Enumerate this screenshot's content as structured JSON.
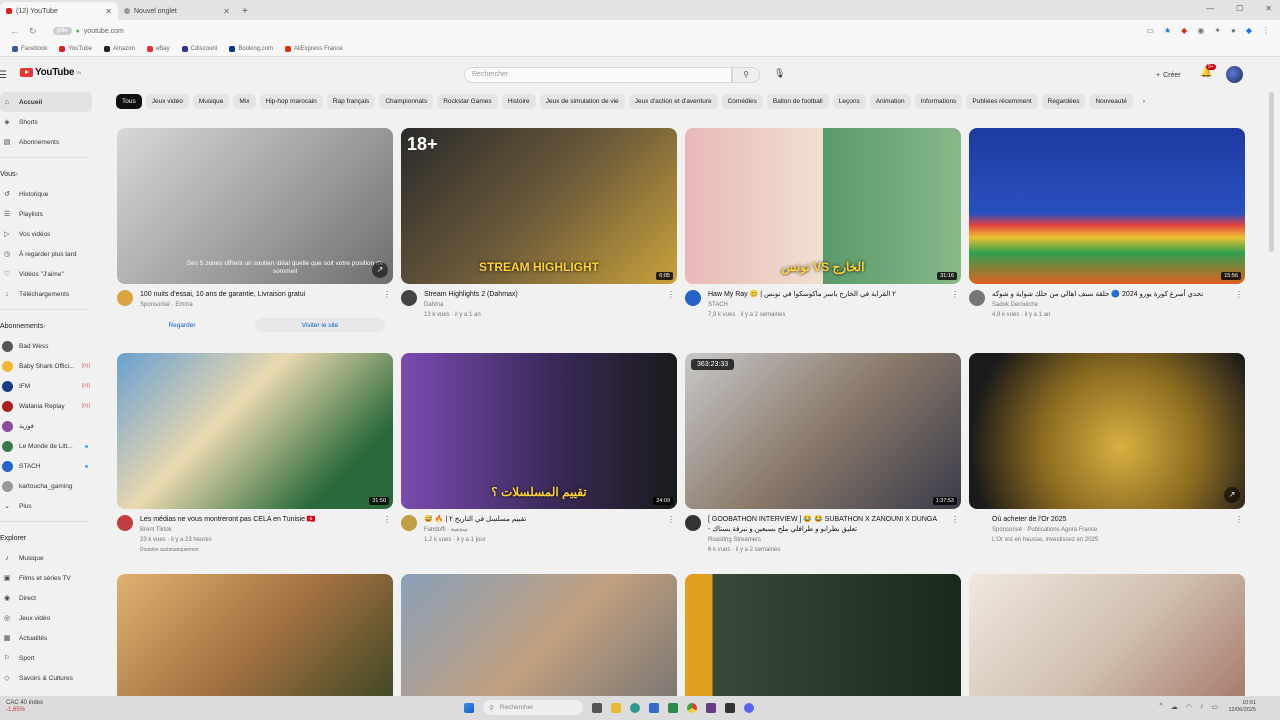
{
  "browser": {
    "tabs": [
      {
        "label": "(12) YouTube",
        "color": "#e02020"
      },
      {
        "label": "Nouvel onglet",
        "color": "#888888"
      }
    ],
    "new_tab": "+",
    "url": "youtube.com",
    "url_pill": "gfile",
    "window_controls": [
      "—",
      "☐",
      "✕"
    ],
    "bookmarks": [
      {
        "label": "Facebook",
        "color": "#3b5998"
      },
      {
        "label": "YouTube",
        "color": "#e02020"
      },
      {
        "label": "Amazon",
        "color": "#222222"
      },
      {
        "label": "eBay",
        "color": "#e53238"
      },
      {
        "label": "Cdiscount",
        "color": "#333399"
      },
      {
        "label": "Booking.com",
        "color": "#003580"
      },
      {
        "label": "AliExpress France",
        "color": "#e62e04"
      }
    ]
  },
  "masthead": {
    "logo": "YouTube",
    "logo_sup": "TN",
    "search_placeholder": "Rechercher",
    "create_label": "Créer",
    "notif_count": "9+"
  },
  "sidebar": {
    "main": [
      {
        "label": "Accueil",
        "icon": "home-icon",
        "glyph": "⌂",
        "active": true
      },
      {
        "label": "Shorts",
        "icon": "shorts-icon",
        "glyph": "◈"
      },
      {
        "label": "Abonnements",
        "icon": "subscriptions-icon",
        "glyph": "▤"
      }
    ],
    "you_header": "Vous",
    "you": [
      {
        "label": "Historique",
        "icon": "history-icon",
        "glyph": "↺"
      },
      {
        "label": "Playlists",
        "icon": "playlist-icon",
        "glyph": "☰"
      },
      {
        "label": "Vos vidéos",
        "icon": "your-videos-icon",
        "glyph": "▷"
      },
      {
        "label": "À regarder plus tard",
        "icon": "watch-later-icon",
        "glyph": "◷"
      },
      {
        "label": "Vidéos \"J'aime\"",
        "icon": "like-icon",
        "glyph": "♡"
      },
      {
        "label": "Téléchargements",
        "icon": "download-icon",
        "glyph": "↓"
      }
    ],
    "subs_header": "Abonnements",
    "subs": [
      {
        "label": "Bad Wess",
        "color": "#555555",
        "mark": ""
      },
      {
        "label": "Baby Shark Offici...",
        "color": "#f2b632",
        "mark": "live"
      },
      {
        "label": "IFM",
        "color": "#1a3b8a",
        "mark": "live"
      },
      {
        "label": "Watania Replay",
        "color": "#b01e1e",
        "mark": "live"
      },
      {
        "label": "فوزية",
        "color": "#8a4b9e",
        "mark": ""
      },
      {
        "label": "Le Monde de Litt...",
        "color": "#3a7a4a",
        "mark": "dot"
      },
      {
        "label": "STACH",
        "color": "#2563c9",
        "mark": "dot"
      },
      {
        "label": "kartoucha_gaming",
        "color": "#999999",
        "mark": ""
      }
    ],
    "more_label": "Plus",
    "explore_header": "Explorer",
    "explore": [
      {
        "label": "Musique",
        "icon": "music-icon",
        "glyph": "♪"
      },
      {
        "label": "Films et séries TV",
        "icon": "film-icon",
        "glyph": "▣"
      },
      {
        "label": "Direct",
        "icon": "live-icon",
        "glyph": "◉"
      },
      {
        "label": "Jeux vidéo",
        "icon": "gaming-icon",
        "glyph": "◎"
      },
      {
        "label": "Actualités",
        "icon": "news-icon",
        "glyph": "▦"
      },
      {
        "label": "Sport",
        "icon": "sport-icon",
        "glyph": "⚐"
      },
      {
        "label": "Savoirs & Cultures",
        "icon": "learning-icon",
        "glyph": "◇"
      }
    ]
  },
  "chips": [
    "Tous",
    "Jeux vidéo",
    "Musique",
    "Mix",
    "Hip-hop marocain",
    "Rap français",
    "Championnats",
    "Rockstar Games",
    "Histoire",
    "Jeux de simulation de vie",
    "Jeux d'action et d'aventure",
    "Comédies",
    "Ballon de football",
    "Leçons",
    "Animation",
    "Informations",
    "Publiées récemment",
    "Regardées",
    "Nouveauté"
  ],
  "videos": [
    {
      "title": "100 nuits d'essai, 10 ans de garantie, Livraison gratui",
      "channel": "Sponsorisé · Emma",
      "stats": "",
      "duration": "",
      "thumb": "linear-gradient(135deg,#d8d8d8,#9a9a9a 60%,#6e6e6e)",
      "avatar": "#d9a441",
      "ad": true,
      "overlay": "Ses 5 zones offrent un soutien idéal quelle que soit votre position de sommeil",
      "ad_btn1": "Regarder",
      "ad_btn2": "Visiter le site"
    },
    {
      "title": "Stream Highlights 2 (Dahmax)",
      "channel": "Dahma",
      "stats": "13 k vues · il y a 1 an",
      "duration": "6:05",
      "thumb": "linear-gradient(135deg,#2a2a2a,#6b5a3a 50%,#c9a13a)",
      "avatar": "#444444",
      "label": "STREAM HIGHLIGHT",
      "badge": "18+"
    },
    {
      "title": "Haw My Ray 😊 | ٢ القرابة في الخارج ياسر ماكوسكوا في تونس",
      "channel": "STACH",
      "stats": "7,9 k vues · il y a 2 semaines",
      "duration": "31:16",
      "thumb": "linear-gradient(90deg,#e8b8b8 0%,#f0e0d0 50%,#5a9a6a 50%,#88b888 100%)",
      "avatar": "#2563c9",
      "label": "تونس VS الخارج"
    },
    {
      "title": "تحدي أسرع كورة يورو 2024 🔵 حلقة نسف اهالي من حلك شواية و شوكه",
      "channel": "Sadok Derouiche",
      "stats": "4,9 k vues · il y a 1 an",
      "duration": "15:56",
      "thumb": "linear-gradient(180deg,#1e3aa0 0%,#2a50c0 55%,#e04040 62%,#f0c030 70%,#30a050 80%,#e06020 100%)",
      "avatar": "#777777"
    },
    {
      "title": "Les médias ne vous montreront pas CELA en Tunisie 🇹🇳",
      "channel": "Brent Tiktok",
      "stats": "33 k vues · il y a 23 heures",
      "duration": "31:50",
      "thumb": "linear-gradient(135deg,#6aa0d0,#e9d8b0 40%,#2a6a3a 80%)",
      "avatar": "#c04040",
      "extra": "Doublée automatiquement"
    },
    {
      "title": "😅 🔥 | تقييم مسلسل في التاريخ ٢",
      "channel": "Fahdoffi · سجعية",
      "stats": "1,2 k vues · il y a 1 jour",
      "duration": "24:09",
      "thumb": "linear-gradient(90deg,#7a4ab0 0%,#3a2a5a 55%,#1a1a1a 100%)",
      "avatar": "#c0a040",
      "label": "تقييم المسلسلات ؟"
    },
    {
      "title": "[ GOOBATHON INTERVIEW ] 😂 😂 SUBATHON X ZANOUNI X DUNGA - تعليق بطرابو و طرافلي ملح بسبعين و نبرقة بستاك",
      "channel": "Roasting Streamers",
      "stats": "6 k vues · il y a 2 semaines",
      "duration": "1:37:53",
      "thumb": "linear-gradient(135deg,#c8c8c8,#8a7a6a 50%,#3a3a4a)",
      "avatar": "#333333",
      "live_counter": "363:23:33"
    },
    {
      "title": "Où acheter de l'Or 2025",
      "channel": "Sponsorisé · Publications Agora France",
      "stats": "L'Or est en hausse, investissez en 2025",
      "duration": "",
      "thumb": "radial-gradient(circle at 55% 60%,#d8b040,#8a6a20 45%,#1a1a1a 85%)",
      "avatar": "",
      "ad": true
    },
    {
      "title": "",
      "channel": "",
      "stats": "",
      "duration": "",
      "thumb": "linear-gradient(135deg,#e0b070,#a07040 50%,#304020)",
      "avatar": ""
    },
    {
      "title": "",
      "channel": "",
      "stats": "",
      "duration": "",
      "thumb": "linear-gradient(135deg,#8aa0b8,#c0a080 50%,#707070)",
      "avatar": ""
    },
    {
      "title": "",
      "channel": "",
      "stats": "",
      "duration": "",
      "thumb": "linear-gradient(90deg,#e0a020 0%,#e0a020 10%,#3a4a3a 10%,#1a2a1a 100%)",
      "avatar": ""
    },
    {
      "title": "",
      "channel": "",
      "stats": "",
      "duration": "",
      "thumb": "linear-gradient(135deg,#f0e8e0,#d0c0b0 50%,#a07060)",
      "avatar": ""
    }
  ],
  "taskbar": {
    "ticker_name": "CAC 40 index",
    "ticker_change": "-1,65%",
    "search_placeholder": "Rechercher",
    "time": "10:51",
    "date": "12/06/2025"
  },
  "status_url": "www.youtube.com/watch?v=..."
}
